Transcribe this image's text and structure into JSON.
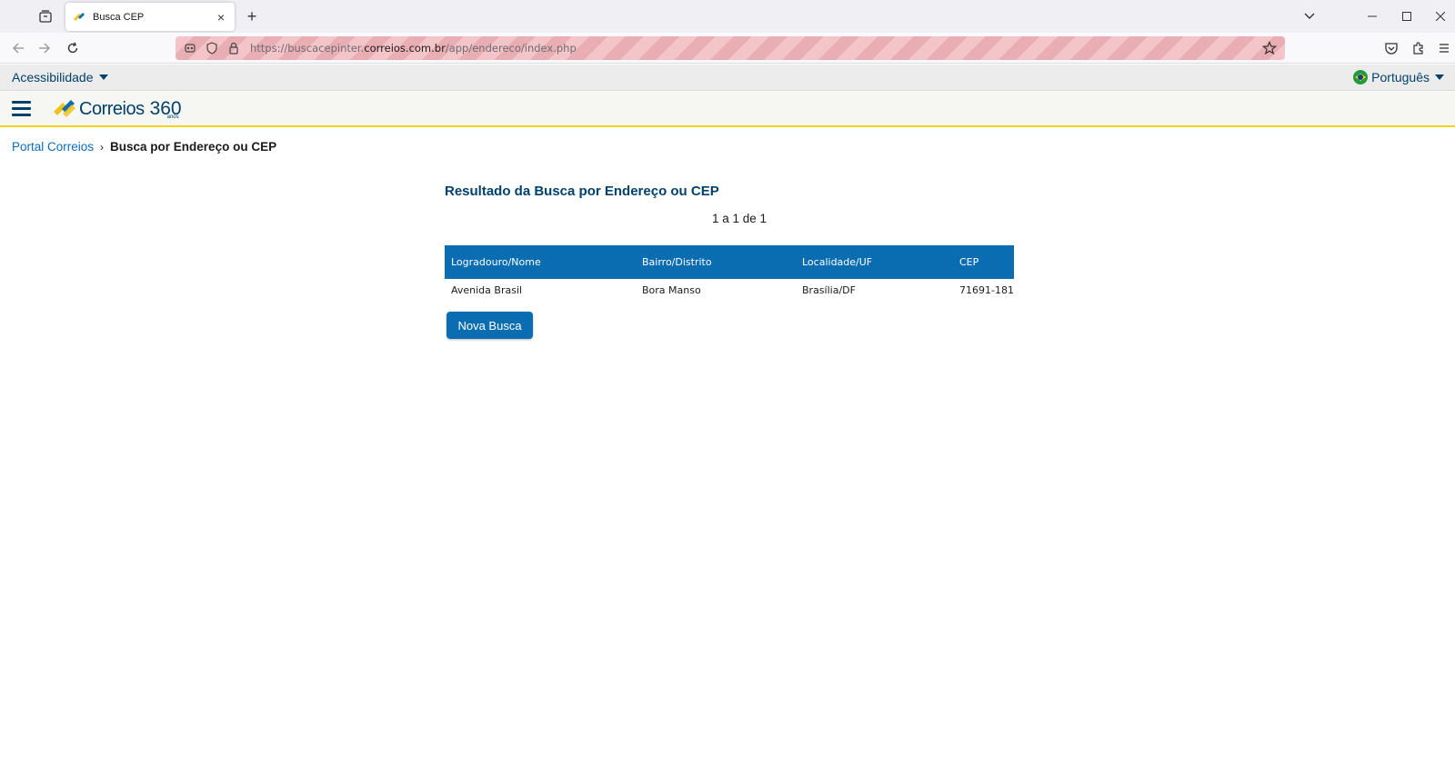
{
  "browser": {
    "tab_title": "Busca CEP",
    "url_prefix": "https://buscacepinter.",
    "url_host": "correios.com.br",
    "url_path": "/app/endereco/index.php"
  },
  "site": {
    "accessibility_label": "Acessibilidade",
    "language_label": "Português",
    "logo_text": "Correios",
    "logo_number": "360",
    "logo_sub": "anos"
  },
  "breadcrumb": {
    "home": "Portal Correios",
    "separator": "›",
    "current": "Busca por Endereço ou CEP"
  },
  "result": {
    "title": "Resultado da Busca por Endereço ou CEP",
    "pager": "1 a 1 de 1",
    "columns": [
      "Logradouro/Nome",
      "Bairro/Distrito",
      "Localidade/UF",
      "CEP"
    ],
    "rows": [
      [
        "Avenida Brasil",
        "Bora Manso",
        "Brasília/DF",
        "71691-181"
      ]
    ],
    "new_search_label": "Nova Busca"
  },
  "colors": {
    "primary_blue": "#0a6db2",
    "dark_blue": "#00416b",
    "accent_yellow": "#f2d024"
  }
}
